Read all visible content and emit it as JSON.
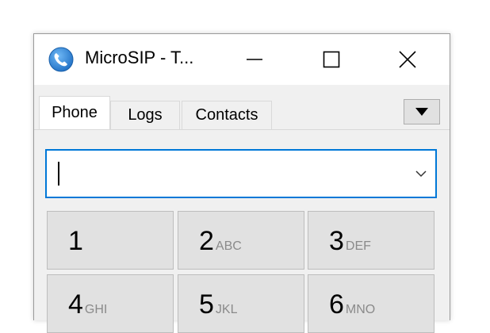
{
  "window": {
    "title": "MicroSIP - T..."
  },
  "tabs": [
    {
      "label": "Phone",
      "active": true
    },
    {
      "label": "Logs",
      "active": false
    },
    {
      "label": "Contacts",
      "active": false
    }
  ],
  "dial": {
    "value": "",
    "placeholder": ""
  },
  "keypad": [
    {
      "digit": "1",
      "letters": ""
    },
    {
      "digit": "2",
      "letters": "ABC"
    },
    {
      "digit": "3",
      "letters": "DEF"
    },
    {
      "digit": "4",
      "letters": "GHI"
    },
    {
      "digit": "5",
      "letters": "JKL"
    },
    {
      "digit": "6",
      "letters": "MNO"
    }
  ],
  "icons": {
    "app": "phone-handset-icon",
    "minimize": "minimize-icon",
    "maximize": "maximize-icon",
    "close": "close-icon",
    "menu": "triangle-down-icon",
    "dropdown": "chevron-down-icon"
  },
  "colors": {
    "accent": "#0078d7",
    "key_bg": "#e1e1e1",
    "app_icon": "#2a7fd4"
  }
}
